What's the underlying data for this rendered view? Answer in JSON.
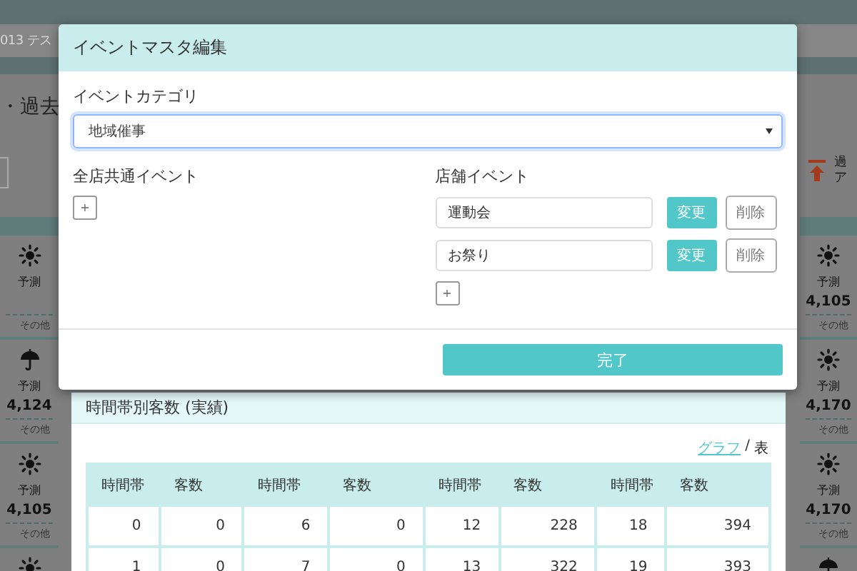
{
  "page": {
    "header_text": "013 テス",
    "title": "・過去",
    "side_note": [
      "過",
      "ア"
    ]
  },
  "left_cards": [
    {
      "kind": "sunny",
      "forecast_label": "予測",
      "other_label": "その他"
    },
    {
      "kind": "rainy",
      "forecast_label": "予測",
      "value": "4,124",
      "other_label": "その他"
    },
    {
      "kind": "sunny",
      "forecast_label": "予測",
      "value": "4,105",
      "other_label": "その他"
    },
    {
      "kind": "sunny"
    }
  ],
  "right_cards": [
    {
      "kind": "sunny",
      "forecast_label": "予測",
      "value": "4,105",
      "other_label": "その他"
    },
    {
      "kind": "sunny",
      "forecast_label": "予測",
      "value": "4,170",
      "other_label": "その他"
    },
    {
      "kind": "sunny",
      "forecast_label": "予測",
      "value": "4,170",
      "other_label": "その他"
    },
    {
      "kind": "rainy"
    }
  ],
  "modal": {
    "title": "イベントマスタ編集",
    "category_label": "イベントカテゴリ",
    "category_value": "地域催事",
    "common_events": {
      "label": "全店共通イベント",
      "add_button": "+"
    },
    "store_events": {
      "label": "店舗イベント",
      "items": [
        {
          "name": "運動会",
          "edit_button": "変更",
          "delete_button": "削除"
        },
        {
          "name": "お祭り",
          "edit_button": "変更",
          "delete_button": "削除"
        }
      ],
      "add_button": "+"
    },
    "done_button": "完了"
  },
  "panel": {
    "title": "時間帯別客数 (実績)",
    "view_links": [
      {
        "label": "グラフ",
        "selected": false
      },
      {
        "label": "表",
        "selected": true
      }
    ],
    "view_separator": "/",
    "table": {
      "columns": [
        "時間帯",
        "客数",
        "時間帯",
        "客数",
        "時間帯",
        "客数",
        "時間帯",
        "客数"
      ],
      "rows": [
        [
          "0",
          "0",
          "6",
          "0",
          "12",
          "228",
          "18",
          "394"
        ],
        [
          "1",
          "0",
          "7",
          "0",
          "13",
          "322",
          "19",
          "393"
        ]
      ]
    }
  }
}
